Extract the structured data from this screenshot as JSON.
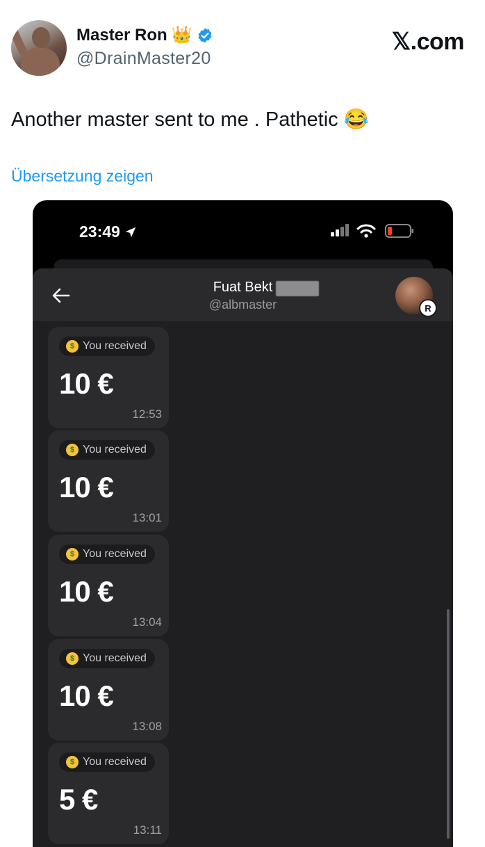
{
  "tweet": {
    "author": {
      "display_name": "Master Ron",
      "crown": "👑",
      "handle": "@DrainMaster20",
      "verified": true
    },
    "brand": "𝕏.com",
    "text": "Another master sent to me . Pathetic 😂",
    "translate_label": "Übersetzung zeigen"
  },
  "phone": {
    "status_bar": {
      "time": "23:49",
      "battery_color": "#ff3b30"
    },
    "chat": {
      "contact_name": "Fuat Bekt",
      "contact_handle": "@albmaster",
      "badge": "R",
      "messages": [
        {
          "label": "You received",
          "amount": "10 €",
          "time": "12:53"
        },
        {
          "label": "You received",
          "amount": "10 €",
          "time": "13:01"
        },
        {
          "label": "You received",
          "amount": "10 €",
          "time": "13:04"
        },
        {
          "label": "You received",
          "amount": "10 €",
          "time": "13:08"
        },
        {
          "label": "You received",
          "amount": "5 €",
          "time": "13:11"
        }
      ]
    }
  },
  "colors": {
    "link": "#1d9bf0",
    "verified": "#1d9bf0",
    "chat_bg": "#1f1f21",
    "card_bg": "#2b2b2d"
  }
}
